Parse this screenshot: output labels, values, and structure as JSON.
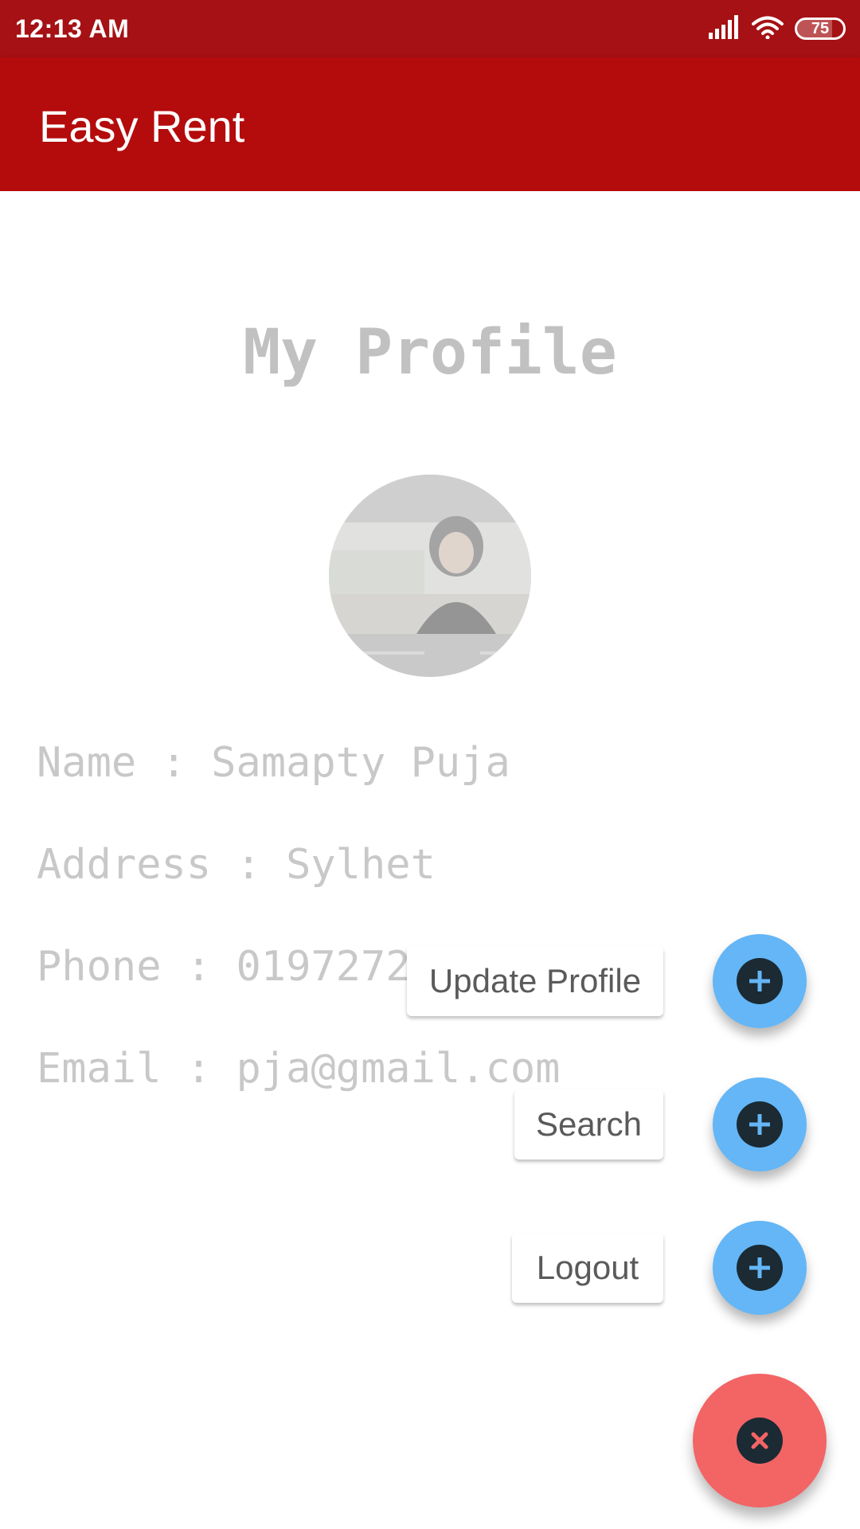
{
  "status_bar": {
    "time": "12:13 AM",
    "battery_level": "75",
    "battery_fraction": 0.75,
    "icons": [
      "signal-icon",
      "wifi-icon",
      "battery-icon"
    ]
  },
  "app_bar": {
    "title": "Easy Rent",
    "color": "#b40b0c"
  },
  "profile": {
    "title": "My Profile",
    "name_line": "Name : Samapty Puja",
    "address_line": "Address : Sylhet",
    "phone_line": "Phone : 0197272",
    "email_line": "Email : pja@gmail.com"
  },
  "fab_menu": {
    "items": [
      {
        "label": "Update Profile",
        "icon": "plus-icon"
      },
      {
        "label": "Search",
        "icon": "plus-icon"
      },
      {
        "label": "Logout",
        "icon": "plus-icon"
      }
    ],
    "main_icon": "close-icon",
    "mini_fab_color": "#64b6f6",
    "main_fab_color": "#f36465"
  }
}
